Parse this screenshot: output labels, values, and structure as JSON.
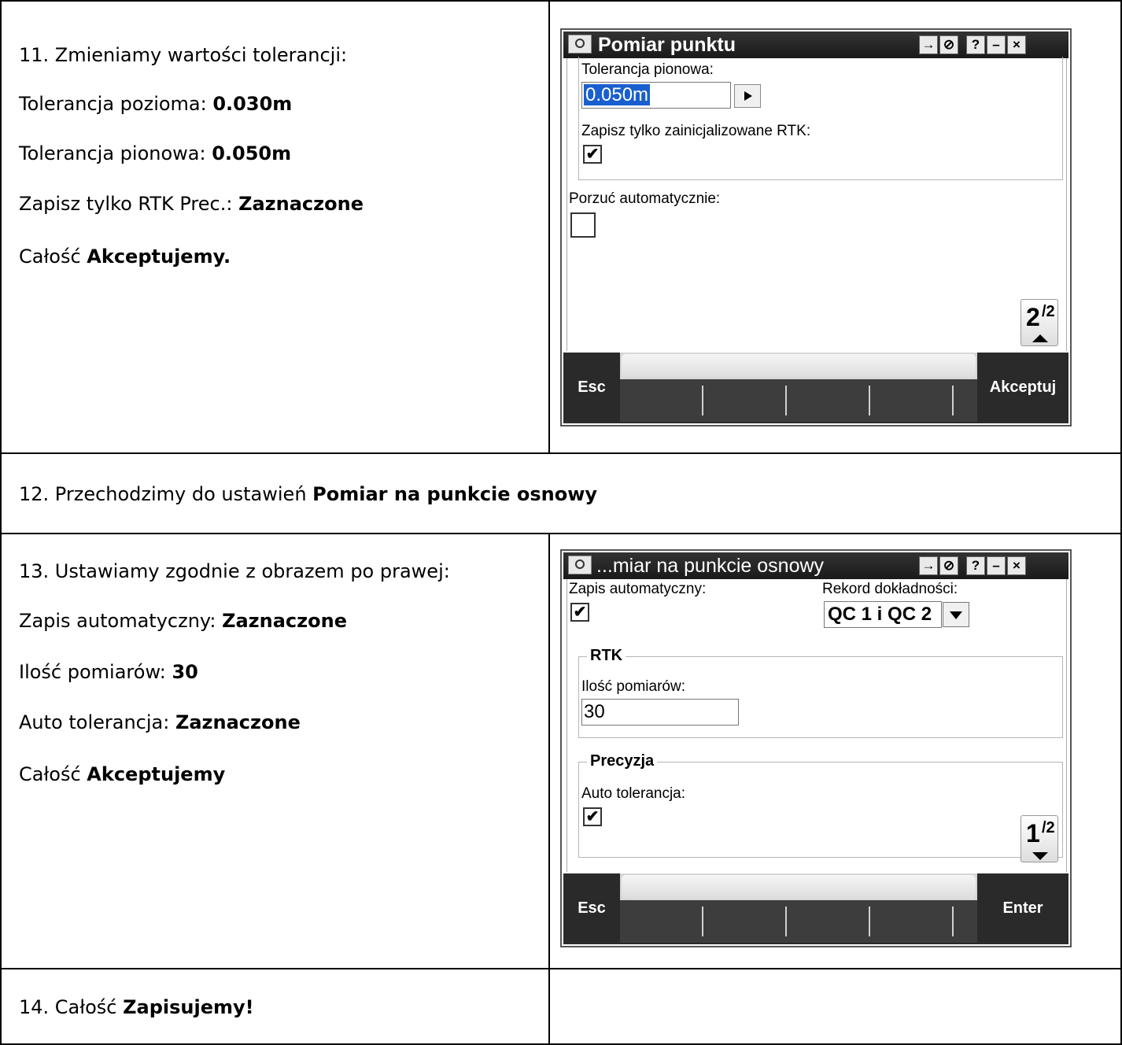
{
  "rows": {
    "r11": {
      "lines": [
        {
          "prefix": "11. Zmieniamy wartości tolerancji:",
          "bold": ""
        },
        {
          "prefix": "Tolerancja pozioma: ",
          "bold": "0.030m"
        },
        {
          "prefix": "Tolerancja pionowa: ",
          "bold": "0.050m"
        },
        {
          "prefix": "Zapisz tylko RTK Prec.: ",
          "bold": "Zaznaczone"
        },
        {
          "prefix": "Całość ",
          "bold": "Akceptujemy."
        }
      ]
    },
    "r12": {
      "prefix": "12. Przechodzimy do ustawień ",
      "bold": "Pomiar na punkcie osnowy"
    },
    "r13": {
      "lines": [
        {
          "prefix": "13. Ustawiamy zgodnie z obrazem po prawej:",
          "bold": ""
        },
        {
          "prefix": "Zapis automatyczny: ",
          "bold": "Zaznaczone"
        },
        {
          "prefix": "Ilość pomiarów: ",
          "bold": "30"
        },
        {
          "prefix": "Auto tolerancja: ",
          "bold": "Zaznaczone"
        },
        {
          "prefix": "Całość ",
          "bold": "Akceptujemy"
        }
      ]
    },
    "r14": {
      "prefix": "14. Całość ",
      "bold": "Zapisujemy!"
    }
  },
  "screen1": {
    "title": "Pomiar punktu",
    "title_buttons": [
      "→",
      "⊘",
      "?",
      "–",
      "×"
    ],
    "vertical_tolerance_label": "Tolerancja pionowa:",
    "vertical_tolerance_value": "0.050m",
    "rtk_only_label": "Zapisz tylko zainicjalizowane RTK:",
    "rtk_only_checked": "✔",
    "auto_abandon_label": "Porzuć automatycznie:",
    "auto_abandon_checked": "",
    "page_num": "2",
    "page_total": "/2",
    "esc_label": "Esc",
    "accept_label": "Akceptuj"
  },
  "screen2": {
    "title": "...miar na punkcie osnowy",
    "title_buttons": [
      "→",
      "⊘",
      "?",
      "–",
      "×"
    ],
    "auto_store_label": "Zapis automatyczny:",
    "auto_store_checked": "✔",
    "quality_record_label": "Rekord dokładności:",
    "quality_record_value": "QC 1 i QC 2",
    "rtk_group": "RTK",
    "measurement_count_label": "Ilość pomiarów:",
    "measurement_count_value": "30",
    "precision_group": "Precyzja",
    "auto_tolerance_label": "Auto tolerancja:",
    "auto_tolerance_checked": "✔",
    "page_num": "1",
    "page_total": "/2",
    "esc_label": "Esc",
    "enter_label": "Enter"
  },
  "colors": {
    "selection": "#1a5fcf",
    "titlebar": "#222222",
    "softkey_bar": "#2c2c2c"
  },
  "icons": [
    "app-icon",
    "login-icon",
    "block-icon",
    "help-icon",
    "minimize-icon",
    "close-icon",
    "right-arrow-icon",
    "dropdown-arrow-icon",
    "page-up-icon",
    "page-down-icon"
  ]
}
